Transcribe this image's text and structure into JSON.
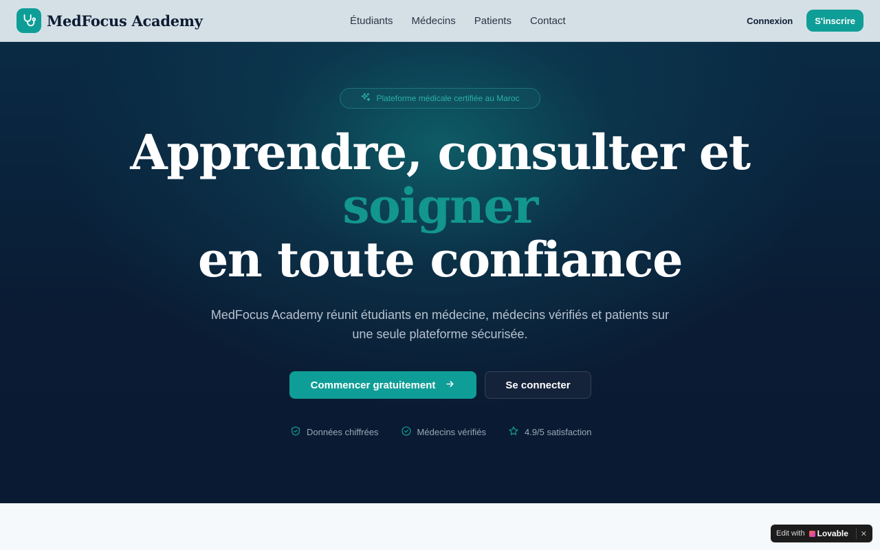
{
  "nav": {
    "brand": "MedFocus Academy",
    "links": [
      "Étudiants",
      "Médecins",
      "Patients",
      "Contact"
    ],
    "login_label": "Connexion",
    "signup_label": "S'inscrire"
  },
  "hero": {
    "badge": "Plateforme médicale certifiée au Maroc",
    "title_line1": "Apprendre, consulter et",
    "title_accent": "soigner",
    "title_line3": "en toute confiance",
    "subtitle": "MedFocus Academy réunit étudiants en médecine, médecins vérifiés et patients sur une seule plateforme sécurisée.",
    "cta_primary": "Commencer gratuitement",
    "cta_secondary": "Se connecter",
    "trust": [
      "Données chiffrées",
      "Médecins vérifiés",
      "4.9/5 satisfaction"
    ]
  },
  "lovable": {
    "edit_with": "Edit with",
    "brand": "Lovable"
  },
  "colors": {
    "accent": "#0f9e97",
    "hero_bg": "#0a1b33",
    "nav_bg": "#d5e0e6"
  }
}
